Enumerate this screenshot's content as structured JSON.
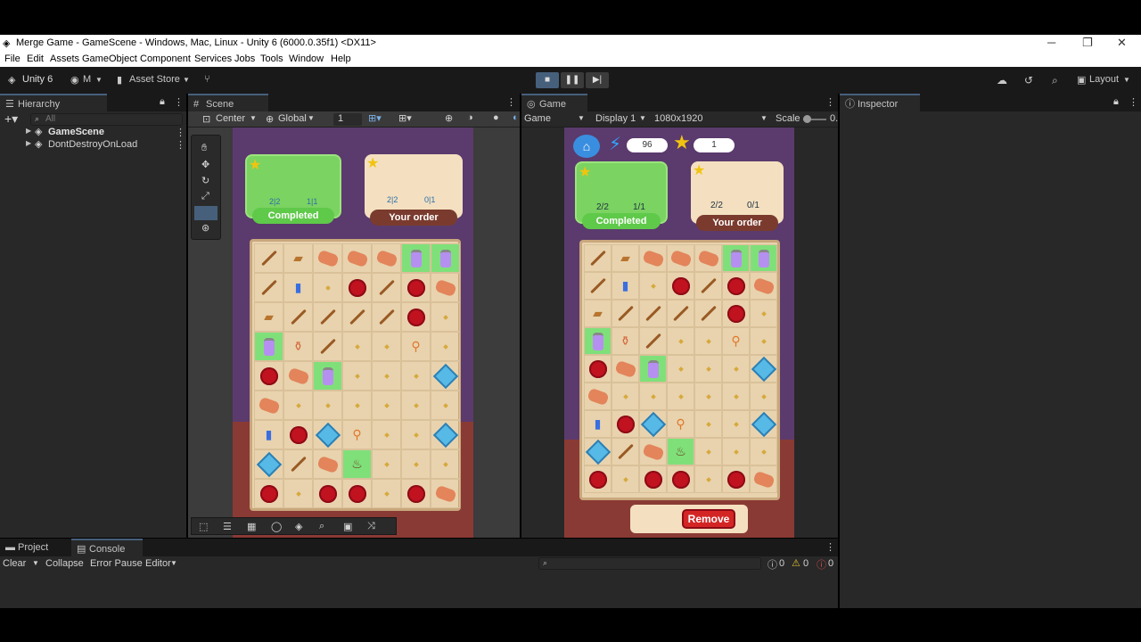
{
  "window": {
    "title": "Merge Game - GameScene - Windows, Mac, Linux - Unity 6 (6000.0.35f1) <DX11>",
    "controls": [
      "─",
      "❐",
      "✕"
    ]
  },
  "menu": [
    "File",
    "Edit",
    "Assets",
    "GameObject",
    "Component",
    "Services",
    "Jobs",
    "Tools",
    "Window",
    "Help"
  ],
  "toolbar": {
    "unity_label": "Unity 6",
    "account_label": "M",
    "asset_store_label": "Asset Store",
    "layout_label": "Layout"
  },
  "hierarchy": {
    "tab": "Hierarchy",
    "search_placeholder": "All",
    "items": [
      "GameScene",
      "DontDestroyOnLoad"
    ]
  },
  "scene": {
    "tab": "Scene",
    "pivot": "Center",
    "space": "Global",
    "grid_value": "1"
  },
  "game": {
    "tab": "Game",
    "mode": "Game",
    "display": "Display 1",
    "resolution": "1080x1920",
    "scale_label": "Scale",
    "scale_value": "0."
  },
  "inspector": {
    "tab": "Inspector"
  },
  "bottom": {
    "project_tab": "Project",
    "console_tab": "Console",
    "clear": "Clear",
    "collapse": "Collapse",
    "error_pause": "Error Pause",
    "editor": "Editor",
    "count_log": "0",
    "count_warn": "0",
    "count_err": "0"
  },
  "game_ui": {
    "energy": "96",
    "stars": "1",
    "order1": {
      "counts": [
        "2/2",
        "1/1"
      ],
      "button": "Completed"
    },
    "order2": {
      "counts": [
        "2/2",
        "0/1"
      ],
      "button": "Your order"
    },
    "remove_button": "Remove"
  },
  "scene_ui": {
    "order1": {
      "counts": [
        "2|2",
        "1|1"
      ],
      "button": "Completed"
    },
    "order2": {
      "counts": [
        "2|2",
        "0|1"
      ],
      "button": "Your order"
    }
  },
  "colors": {
    "editor_bg": "#282828",
    "accent": "#46607c",
    "completed_green": "#5fc94a",
    "order_brown": "#7a3b2e",
    "remove_red": "#d42525"
  },
  "board": {
    "rows": [
      [
        "wand",
        "chest",
        "scroll",
        "scroll",
        "scroll",
        "potion-g",
        "potion-g"
      ],
      [
        "wand",
        "vial",
        "dot",
        "seal",
        "wand",
        "seal",
        "scroll"
      ],
      [
        "chest",
        "wand",
        "wand",
        "wand",
        "wand",
        "seal",
        "dot"
      ],
      [
        "potion-g",
        "vase",
        "wand",
        "dot",
        "dot",
        "broom",
        "dot"
      ],
      [
        "seal",
        "scroll",
        "potion-g",
        "dot",
        "dot",
        "dot",
        "gem"
      ],
      [
        "scroll",
        "dot",
        "dot",
        "dot",
        "dot",
        "dot",
        "dot"
      ],
      [
        "vial",
        "seal",
        "gem",
        "broom",
        "dot",
        "dot",
        "gem"
      ],
      [
        "gem",
        "wand",
        "scroll",
        "candle-g",
        "dot",
        "dot",
        "dot"
      ],
      [
        "seal",
        "dot",
        "seal",
        "seal",
        "dot",
        "seal",
        "scroll"
      ]
    ]
  }
}
